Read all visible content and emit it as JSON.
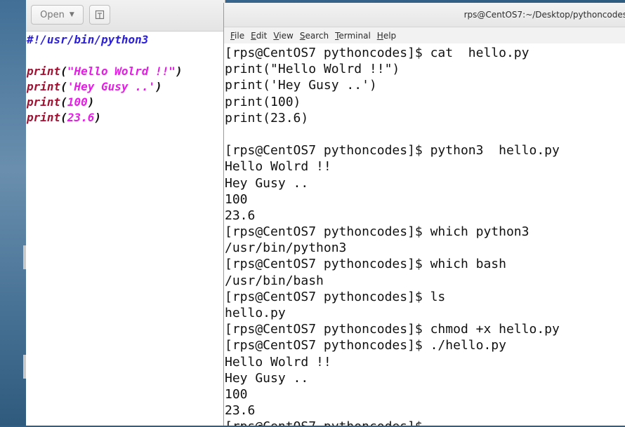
{
  "gedit": {
    "open_label": "Open",
    "lines": [
      {
        "type": "shebang",
        "text": "#!/usr/bin/python3"
      },
      {
        "type": "blank"
      },
      {
        "type": "print",
        "fn": "print",
        "open": "(",
        "arg": "\"Hello Wolrd !!\"",
        "close": ")"
      },
      {
        "type": "print",
        "fn": "print",
        "open": "(",
        "arg": "'Hey Gusy ..'",
        "close": ")"
      },
      {
        "type": "print",
        "fn": "print",
        "open": "(",
        "arg": "100",
        "close": ")"
      },
      {
        "type": "print",
        "fn": "print",
        "open": "(",
        "arg": "23.6",
        "close": ")"
      }
    ]
  },
  "terminal": {
    "title": "rps@CentOS7:~/Desktop/pythoncodes",
    "menu": [
      {
        "key": "F",
        "rest": "ile"
      },
      {
        "key": "E",
        "rest": "dit"
      },
      {
        "key": "V",
        "rest": "iew"
      },
      {
        "key": "S",
        "rest": "earch"
      },
      {
        "key": "T",
        "rest": "erminal"
      },
      {
        "key": "H",
        "rest": "elp"
      }
    ],
    "lines": [
      "[rps@CentOS7 pythoncodes]$ cat  hello.py",
      "print(\"Hello Wolrd !!\")",
      "print('Hey Gusy ..')",
      "print(100)",
      "print(23.6)",
      "",
      "[rps@CentOS7 pythoncodes]$ python3  hello.py",
      "Hello Wolrd !!",
      "Hey Gusy ..",
      "100",
      "23.6",
      "[rps@CentOS7 pythoncodes]$ which python3",
      "/usr/bin/python3",
      "[rps@CentOS7 pythoncodes]$ which bash",
      "/usr/bin/bash",
      "[rps@CentOS7 pythoncodes]$ ls",
      "hello.py",
      "[rps@CentOS7 pythoncodes]$ chmod +x hello.py",
      "[rps@CentOS7 pythoncodes]$ ./hello.py",
      "Hello Wolrd !!",
      "Hey Gusy ..",
      "100",
      "23.6",
      "[rps@CentOS7 pythoncodes]$ "
    ]
  }
}
